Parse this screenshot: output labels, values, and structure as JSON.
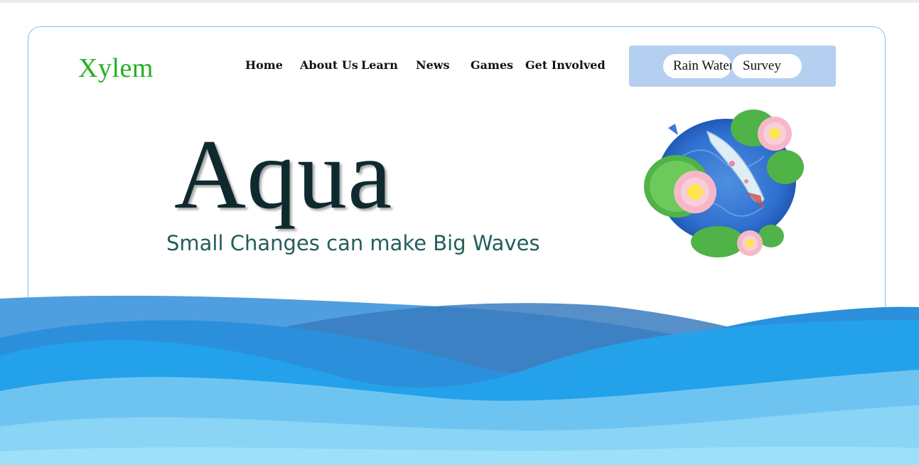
{
  "brand": {
    "logo_text": "Xylem"
  },
  "nav": {
    "items": [
      {
        "label": "Home"
      },
      {
        "label": "About Us"
      },
      {
        "label": "Learn"
      },
      {
        "label": "News"
      },
      {
        "label": "Games"
      },
      {
        "label": "Get Involved"
      }
    ]
  },
  "quick_links": {
    "rain_water_label": "Rain Water",
    "survey_label": "Survey"
  },
  "hero": {
    "title": "Aqua",
    "subtitle": "Small Changes can make Big Waves"
  },
  "colors": {
    "logo": "#22b01f",
    "title": "#0f2a2e",
    "subtitle": "#235e5a",
    "widget_bg": "#b4cff0",
    "card_border": "#7cc6e6"
  },
  "icons": {
    "pond": "koi-pond-lotus-illustration",
    "waves": "ocean-waves-decoration"
  }
}
